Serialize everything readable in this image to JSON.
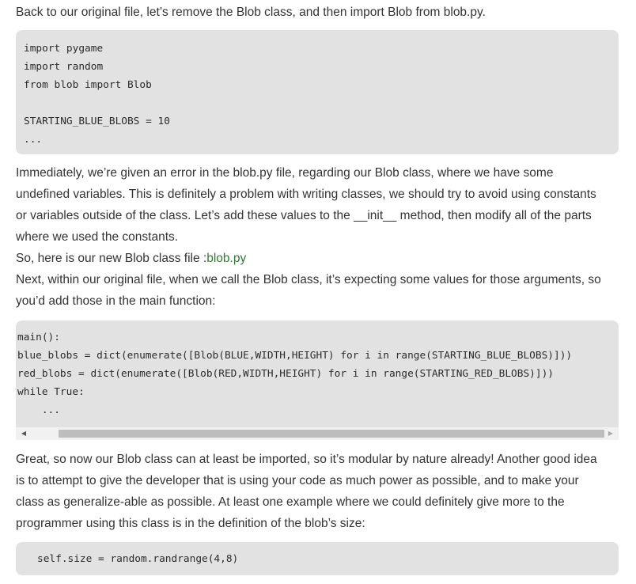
{
  "intro": {
    "text": "Back to our original file, let’s remove the Blob class, and then import Blob from blob.py."
  },
  "code1": {
    "lines": [
      "import pygame",
      "import random",
      "from blob import Blob",
      "",
      "STARTING_BLUE_BLOBS = 10",
      "..."
    ]
  },
  "para2": {
    "lines": [
      "Immediately, we’re given an error in the blob.py file, regarding our Blob class, where we have some",
      "undefined variables. This is definitely a problem with writing classes, we should try to avoid using constants",
      "or variables outside of the class. Let’s add these values to the __init__ method, then modify all of the parts",
      "where we used the constants."
    ]
  },
  "para3": {
    "prefix": "So, here is our new Blob class file :",
    "link": "blob.py"
  },
  "para4": {
    "lines": [
      "Next, within our original file, when we call the Blob class, it’s expecting some values for those arguments, so",
      "you’d add those in the main function:"
    ]
  },
  "code2": {
    "lines": [
      "main():",
      "blue_blobs = dict(enumerate([Blob(BLUE,WIDTH,HEIGHT) for i in range(STARTING_BLUE_BLOBS)]))",
      "red_blobs = dict(enumerate([Blob(RED,WIDTH,HEIGHT) for i in range(STARTING_RED_BLOBS)]))",
      "while True:",
      "    ..."
    ],
    "scroll_left_icon": "triangle-left",
    "scroll_right_icon": "triangle-right"
  },
  "para5": {
    "lines": [
      "Great, so now our Blob class can at least be imported, so it’s modular by nature already! Another good idea",
      "is to attempt to give the developer that is using your code as much power as possible, and to make your",
      "class as generalize-able as possible. At least one example where we could definitely give more to the",
      "programmer using this class is in the definition of the blob’s size:"
    ]
  },
  "code3": {
    "lines": [
      "self.size = random.randrange(4,8)"
    ]
  },
  "colors": {
    "text": "#333333",
    "link": "#2e7d32",
    "code_bg": "#e2e2e2"
  }
}
